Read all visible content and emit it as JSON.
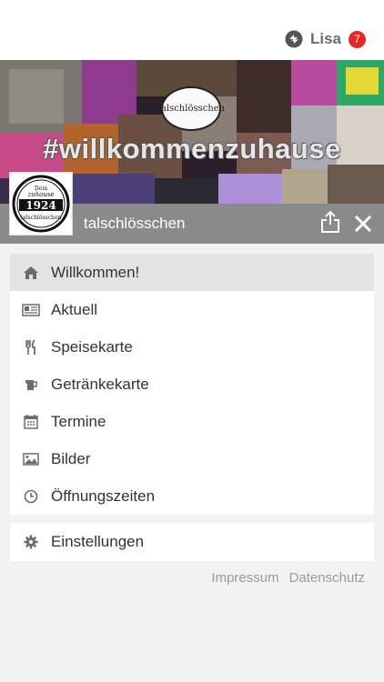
{
  "topbar": {
    "user_name": "Lisa",
    "notification_count": "7"
  },
  "banner": {
    "hashtag": "#willkommenzuhause",
    "center_logo_text": "talschlösschen"
  },
  "venue": {
    "logo_top": "Dein",
    "logo_line2": "zuhause",
    "logo_year": "1924",
    "logo_bottom": "talschlösschen",
    "title": "talschlösschen"
  },
  "menu": {
    "items": [
      {
        "label": "Willkommen!",
        "icon": "home-icon",
        "active": true
      },
      {
        "label": "Aktuell",
        "icon": "newspaper-icon"
      },
      {
        "label": "Speisekarte",
        "icon": "cutlery-icon"
      },
      {
        "label": "Getränkekarte",
        "icon": "drink-icon"
      },
      {
        "label": "Termine",
        "icon": "calendar-icon"
      },
      {
        "label": "Bilder",
        "icon": "image-icon"
      },
      {
        "label": "Öffnungszeiten",
        "icon": "clock-icon"
      }
    ]
  },
  "settings": {
    "label": "Einstellungen",
    "icon": "gear-icon"
  },
  "footer": {
    "impressum": "Impressum",
    "datenschutz": "Datenschutz"
  },
  "colors": {
    "badge": "#e52626",
    "titlebar": "#8a8a8a",
    "active_item": "#e3e3e3",
    "icon": "#6b6b6b"
  }
}
